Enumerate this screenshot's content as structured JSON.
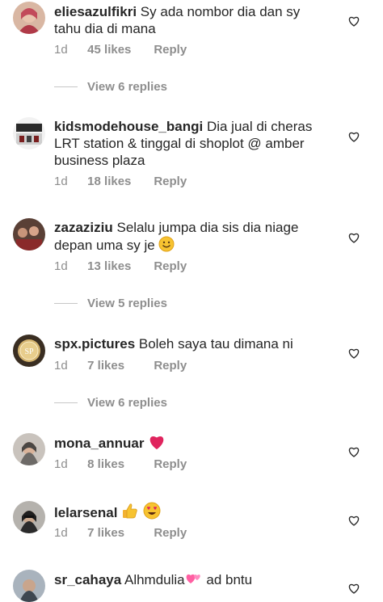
{
  "comments": [
    {
      "username": "eliesazulfikri",
      "text": "Sy ada nombor dia dan sy tahu dia di mana",
      "time": "1d",
      "likes": "45 likes",
      "reply": "Reply",
      "avatar": "profile-photo-woman-hijab"
    },
    {
      "username": "kidsmodehouse_bangi",
      "text": "Dia jual di cheras LRT station & tinggal di shoplot @ amber business plaza",
      "time": "1d",
      "likes": "18 likes",
      "reply": "Reply",
      "avatar": "profile-photo-storefront"
    },
    {
      "username": "zazaziziu",
      "text": "Selalu jumpa dia sis dia niage depan uma sy je",
      "time": "1d",
      "likes": "13 likes",
      "reply": "Reply",
      "avatar": "profile-photo-group"
    },
    {
      "username": "spx.pictures",
      "text": "Boleh saya tau dimana ni",
      "time": "1d",
      "likes": "7 likes",
      "reply": "Reply",
      "avatar": "logo-sp-gold"
    },
    {
      "username": "mona_annuar",
      "text": "",
      "time": "1d",
      "likes": "8 likes",
      "reply": "Reply",
      "avatar": "profile-photo-woman-hijab"
    },
    {
      "username": "lelarsenal",
      "text": "",
      "time": "1d",
      "likes": "7 likes",
      "reply": "Reply",
      "avatar": "profile-photo-woman-hijab"
    },
    {
      "username": "sr_cahaya",
      "text": "Alhmdulia",
      "text2": "ad bntu",
      "avatar": "profile-photo-woman"
    }
  ],
  "view_replies": [
    "View 6 replies",
    "View 5 replies",
    "View 6 replies"
  ],
  "icons": {
    "like": "heart-outline-icon"
  },
  "emojis": [
    "smiling-face-emoji",
    "red-heart-emoji",
    "thumbs-up-emoji",
    "heart-eyes-emoji",
    "pink-hearts-emoji"
  ],
  "colors": {
    "text": "#262626",
    "secondary": "#8e8e8e",
    "divider": "#c7c7c7",
    "heart_red": "#e0245e"
  }
}
